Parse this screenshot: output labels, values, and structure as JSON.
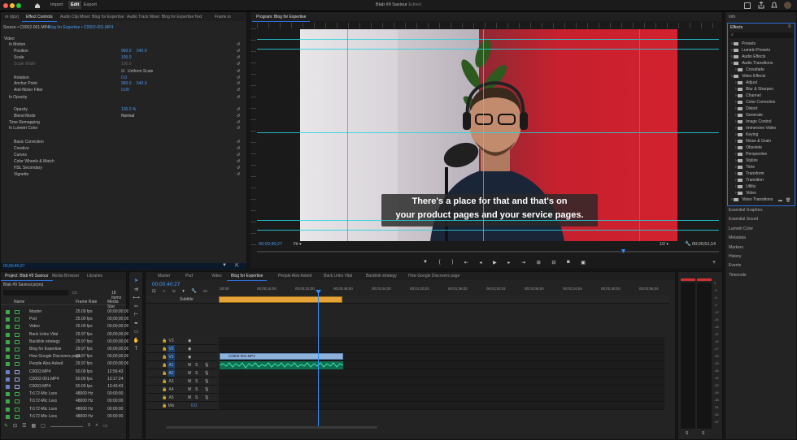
{
  "app": {
    "title": "Blab #9 Saviour",
    "status": "Edited"
  },
  "workspaces": [
    "Import",
    "Edit",
    "Export"
  ],
  "panel_tabs": [
    "ro (dpx)",
    "Effect Controls",
    "Audio Clip Mixer: Blog for Expertise",
    "Audio Track Mixer: Blog for Expertise",
    "Text",
    "Frame.io"
  ],
  "source_line": {
    "source": "Source • C0002-001.MP4",
    "seq": "Blog for Expertise • C0002-001.MP4"
  },
  "effect_controls": [
    {
      "label": "Video",
      "value": "",
      "indent": 0
    },
    {
      "label": "fx Motion",
      "value": "",
      "indent": 1
    },
    {
      "label": "Position",
      "value": "960.0",
      "value2": "540.0",
      "indent": 2
    },
    {
      "label": "Scale",
      "value": "100.0",
      "indent": 2
    },
    {
      "label": "Scale Width",
      "value": "100.0",
      "indent": 2,
      "dim": true
    },
    {
      "label": "Uniform Scale",
      "value": "",
      "indent": 5
    },
    {
      "label": "Rotation",
      "value": "0.0",
      "indent": 2
    },
    {
      "label": "Anchor Point",
      "value": "960.0",
      "value2": "540.0",
      "indent": 2
    },
    {
      "label": "Anti-flicker Filter",
      "value": "0.00",
      "indent": 2
    },
    {
      "label": "fx Opacity",
      "value": "",
      "indent": 1
    },
    {
      "label": "",
      "value": "",
      "indent": 2
    },
    {
      "label": "Opacity",
      "value": "100.0 %",
      "indent": 2
    },
    {
      "label": "Blend Mode",
      "value": "Normal",
      "indent": 2
    },
    {
      "label": "Time Remapping",
      "value": "",
      "indent": 1
    },
    {
      "label": "fx Lumetri Color",
      "value": "",
      "indent": 1
    },
    {
      "label": "",
      "value": "",
      "indent": 2
    },
    {
      "label": "Basic Correction",
      "value": "",
      "indent": 2
    },
    {
      "label": "Creative",
      "value": "",
      "indent": 2
    },
    {
      "label": "Curves",
      "value": "",
      "indent": 2
    },
    {
      "label": "Color Wheels & Match",
      "value": "",
      "indent": 2
    },
    {
      "label": "HSL Secondary",
      "value": "",
      "indent": 2
    },
    {
      "label": "Vignette",
      "value": "",
      "indent": 2
    }
  ],
  "ec_timecode": "00;00;40;27",
  "program": {
    "tab": "Program: Blog for Expertise",
    "caption1": "There's a place for that and that's on",
    "caption2": "your product pages and your service pages.",
    "timecode": "00;00;40;27",
    "fit": "Fit",
    "quality": "1/2",
    "duration": "00;00;51;14"
  },
  "effects_panel": {
    "header": "Info",
    "tab": "Effects",
    "items": [
      {
        "label": "Presets",
        "depth": 0
      },
      {
        "label": "Lumetri Presets",
        "depth": 0
      },
      {
        "label": "Audio Effects",
        "depth": 0
      },
      {
        "label": "Audio Transitions",
        "depth": 0
      },
      {
        "label": "Crossfade",
        "depth": 1
      },
      {
        "label": "Video Effects",
        "depth": 0
      },
      {
        "label": "Adjust",
        "depth": 1
      },
      {
        "label": "Blur & Sharpen",
        "depth": 1
      },
      {
        "label": "Channel",
        "depth": 1
      },
      {
        "label": "Color Correction",
        "depth": 1
      },
      {
        "label": "Distort",
        "depth": 1
      },
      {
        "label": "Generate",
        "depth": 1
      },
      {
        "label": "Image Control",
        "depth": 1
      },
      {
        "label": "Immersive Video",
        "depth": 1
      },
      {
        "label": "Keying",
        "depth": 1
      },
      {
        "label": "Noise & Grain",
        "depth": 1
      },
      {
        "label": "Obsolete",
        "depth": 1
      },
      {
        "label": "Perspective",
        "depth": 1
      },
      {
        "label": "Stylize",
        "depth": 1
      },
      {
        "label": "Time",
        "depth": 1
      },
      {
        "label": "Transform",
        "depth": 1
      },
      {
        "label": "Transition",
        "depth": 1
      },
      {
        "label": "Utility",
        "depth": 1
      },
      {
        "label": "Video",
        "depth": 1
      },
      {
        "label": "Video Transitions",
        "depth": 0
      }
    ],
    "side": [
      "Essential Graphics",
      "Essential Sound",
      "Lumetri Color",
      "Metadata",
      "Markers",
      "History",
      "Events",
      "Timecode"
    ]
  },
  "project": {
    "tabs": [
      "Project: Blab #9 Saviour",
      "Media Browser",
      "Libraries"
    ],
    "file": "Blab #9 Saviour.prproj",
    "count": "18 Items",
    "columns": [
      "Name",
      "Frame Rate",
      "Media Star"
    ],
    "items": [
      {
        "name": "Master",
        "rate": "25.00 fps",
        "start": "00;00;00;00",
        "color": "#3da84a",
        "type": "seq"
      },
      {
        "name": "Pod",
        "rate": "25.00 fps",
        "start": "00;00;00;00",
        "color": "#3da84a",
        "type": "seq"
      },
      {
        "name": "Video",
        "rate": "25.00 fps",
        "start": "00;00;00;00",
        "color": "#3da84a",
        "type": "seq"
      },
      {
        "name": "Back Links Vital",
        "rate": "29.97 fps",
        "start": "00;00;00;00",
        "color": "#3da84a",
        "type": "seq"
      },
      {
        "name": "Backlink strategy",
        "rate": "29.97 fps",
        "start": "00;00;00;00",
        "color": "#3da84a",
        "type": "seq"
      },
      {
        "name": "Blog for Expertise",
        "rate": "29.97 fps",
        "start": "00;00;00;00",
        "color": "#3da84a",
        "type": "seq"
      },
      {
        "name": "How Google Discovers page",
        "rate": "29.97 fps",
        "start": "00;00;00;00",
        "color": "#3da84a",
        "type": "seq"
      },
      {
        "name": "People Also Asked",
        "rate": "29.97 fps",
        "start": "00;00;00;00",
        "color": "#3da84a",
        "type": "seq"
      },
      {
        "name": "C0003.MP4",
        "rate": "50.00 fps",
        "start": "12:56:43",
        "color": "#6b7dc9",
        "type": "clip"
      },
      {
        "name": "C0002-001.MP4",
        "rate": "50.00 fps",
        "start": "13:17:24",
        "color": "#6b7dc9",
        "type": "clip"
      },
      {
        "name": "C0003.MP4",
        "rate": "50.00 fps",
        "start": "13:43:43",
        "color": "#6b7dc9",
        "type": "clip"
      },
      {
        "name": "Tr172-Mic Lsvs",
        "rate": "48000 Hz",
        "start": "00:00:00",
        "color": "#3da84a",
        "type": "audio"
      },
      {
        "name": "Tr172-Mic Lsvs",
        "rate": "48000 Hz",
        "start": "00:00:00",
        "color": "#3da84a",
        "type": "audio"
      },
      {
        "name": "Tr172-Mic Lsvs",
        "rate": "48000 Hz",
        "start": "00:00:00",
        "color": "#3da84a",
        "type": "audio"
      },
      {
        "name": "Tr172-Mic Lsvs",
        "rate": "48000 Hz",
        "start": "00:00:00",
        "color": "#3da84a",
        "type": "audio"
      }
    ]
  },
  "timeline": {
    "tabs": [
      "Master",
      "Pod",
      "Video",
      "Blog for Expertise",
      "People Also Asked",
      "Back Links Vital",
      "Backlink strategy",
      "How Google Discovers page"
    ],
    "timecode": "00;00;40;27",
    "ruler": [
      ":00;00",
      "00;00;16;00",
      "00;00;32;00",
      "00;00;48;00",
      "00;01;04;02",
      "00;01;20;02",
      "00;01;36;02",
      "00;01;52;02",
      "00;02;08;04",
      "00;02;24;04",
      "00;02;40;04",
      "00;02;56;04"
    ],
    "subtitle_track": "Subtitle",
    "clip_name": "C0002-001.MP4",
    "tracks": [
      "V3",
      "V2",
      "V1",
      "A1",
      "A2",
      "A3",
      "A4",
      "A5",
      "Mix"
    ],
    "mix_val": "0.0",
    "meter": [
      "0",
      "-3",
      "-6",
      "-9",
      "-12",
      "-15",
      "-18",
      "-21",
      "-24",
      "-27",
      "-30",
      "-33",
      "-36",
      "-39",
      "-42",
      "-45",
      "-48",
      "-51",
      "-54",
      "-57"
    ],
    "meter_ss": [
      "S",
      "S"
    ]
  }
}
